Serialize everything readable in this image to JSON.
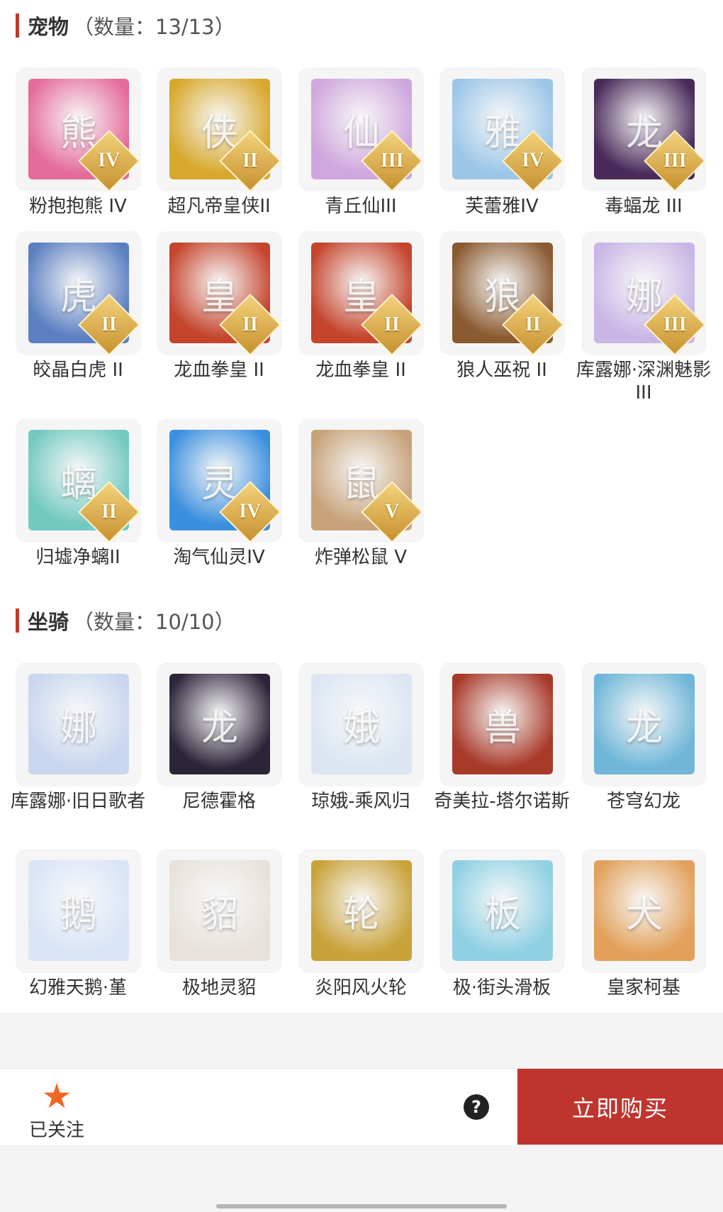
{
  "pets": {
    "title": "宠物",
    "count": "（数量：13/13）",
    "items": [
      {
        "name": "粉抱抱熊 IV",
        "rank": "IV",
        "color": "#e46b9a",
        "glyph": "熊"
      },
      {
        "name": "超凡帝皇侠II",
        "rank": "II",
        "color": "#d8a82c",
        "glyph": "侠"
      },
      {
        "name": "青丘仙III",
        "rank": "III",
        "color": "#cfa6dd",
        "glyph": "仙"
      },
      {
        "name": "芙蕾雅IV",
        "rank": "IV",
        "color": "#9cc6e8",
        "glyph": "雅"
      },
      {
        "name": "毒蝠龙 III",
        "rank": "III",
        "color": "#4a2a5a",
        "glyph": "龙"
      },
      {
        "name": "皎晶白虎 II",
        "rank": "II",
        "color": "#5b7fc1",
        "glyph": "虎"
      },
      {
        "name": "龙血拳皇 II",
        "rank": "II",
        "color": "#c4442c",
        "glyph": "皇"
      },
      {
        "name": "龙血拳皇 II",
        "rank": "II",
        "color": "#c4442c",
        "glyph": "皇"
      },
      {
        "name": "狼人巫祝 II",
        "rank": "II",
        "color": "#8a5a30",
        "glyph": "狼"
      },
      {
        "name": "库露娜·深渊魅影III",
        "rank": "III",
        "color": "#c9b6e6",
        "glyph": "娜"
      },
      {
        "name": "归墟净螭II",
        "rank": "II",
        "color": "#72c9c0",
        "glyph": "螭"
      },
      {
        "name": "淘气仙灵IV",
        "rank": "IV",
        "color": "#3b8fde",
        "glyph": "灵"
      },
      {
        "name": "炸弹松鼠 V",
        "rank": "V",
        "color": "#c7a27a",
        "glyph": "鼠"
      }
    ]
  },
  "mounts": {
    "title": "坐骑",
    "count": "（数量：10/10）",
    "items": [
      {
        "name": "库露娜·旧日歌者",
        "color": "#c9d6ef",
        "glyph": "娜"
      },
      {
        "name": "尼德霍格",
        "color": "#2c2438",
        "glyph": "龙"
      },
      {
        "name": "琼娥-乘风归",
        "color": "#dbe6f2",
        "glyph": "娥"
      },
      {
        "name": "奇美拉-塔尔诺斯",
        "color": "#a83a2a",
        "glyph": "兽"
      },
      {
        "name": "苍穹幻龙",
        "color": "#6fb6d8",
        "glyph": "龙"
      },
      {
        "name": "幻雅天鹅·堇",
        "color": "#d9e4f7",
        "glyph": "鹅"
      },
      {
        "name": "极地灵貂",
        "color": "#e7e2dc",
        "glyph": "貂"
      },
      {
        "name": "炎阳风火轮",
        "color": "#c9a23a",
        "glyph": "轮"
      },
      {
        "name": "极·街头滑板",
        "color": "#8fd0e3",
        "glyph": "板"
      },
      {
        "name": "皇家柯基",
        "color": "#e2a05a",
        "glyph": "犬"
      }
    ]
  },
  "bottom_bar": {
    "follow_label": "已关注",
    "help_label": "?",
    "buy_label": "立即购买"
  }
}
